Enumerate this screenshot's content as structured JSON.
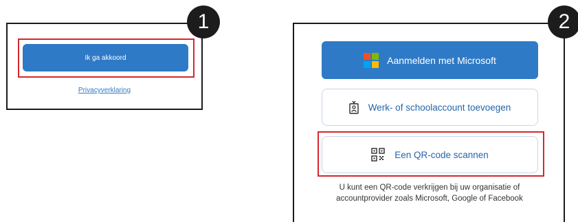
{
  "steps": {
    "first": "1",
    "second": "2"
  },
  "panel1": {
    "agree_button": "Ik ga akkoord",
    "privacy_link": "Privacyverklaring"
  },
  "panel2": {
    "microsoft_button": "Aanmelden met Microsoft",
    "work_account_button": "Werk- of schoolaccount toevoegen",
    "qr_button": "Een QR-code scannen",
    "help_line1": "U kunt een QR-code verkrijgen bij uw organisatie of",
    "help_line2": "accountprovider zoals Microsoft, Google of Facebook"
  },
  "colors": {
    "accent": "#2f7ac6",
    "highlight": "#d6262b",
    "step_badge": "#1c1c1c"
  },
  "icons": {
    "microsoft": "microsoft-logo-icon",
    "work_account": "badge-id-icon",
    "qr": "qr-code-icon"
  }
}
